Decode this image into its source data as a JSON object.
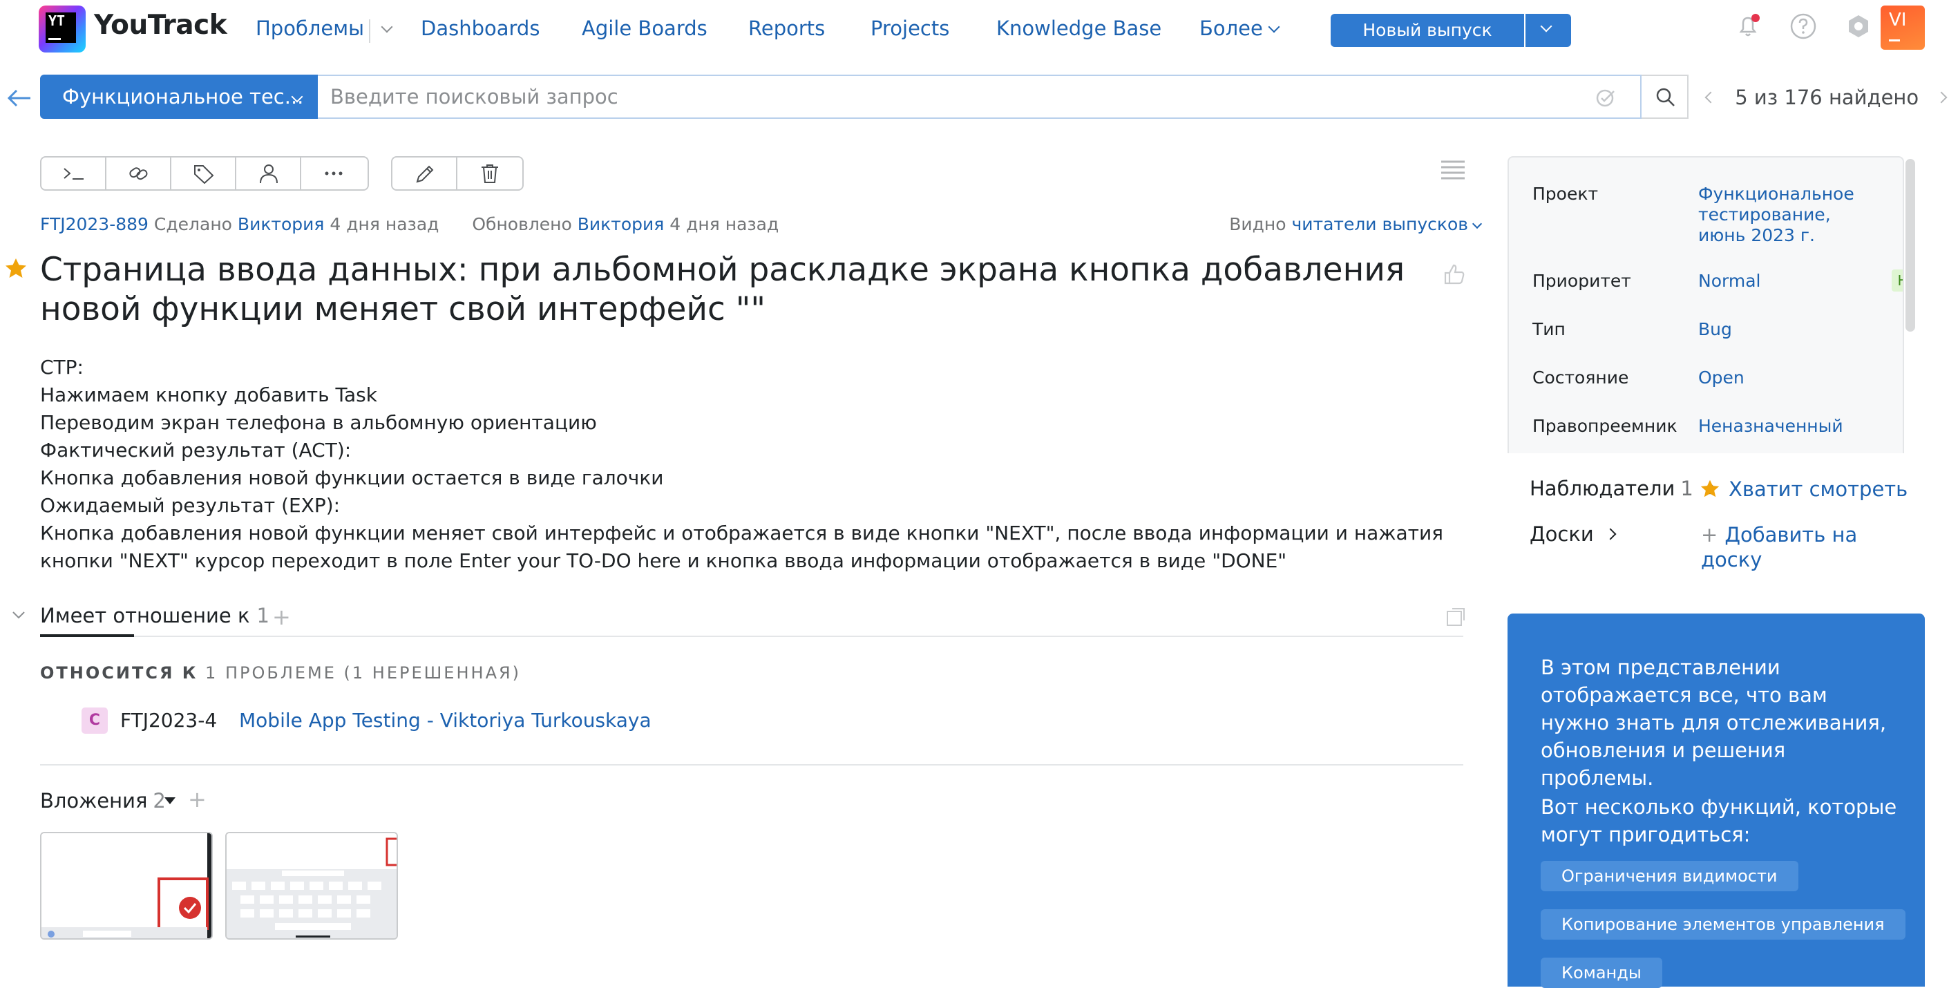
{
  "header": {
    "brand": "YouTrack",
    "logo_mark": "YT",
    "nav": [
      "Проблемы",
      "Dashboards",
      "Agile Boards",
      "Reports",
      "Projects",
      "Knowledge Base",
      "Более"
    ],
    "new_issue_label": "Новый выпуск",
    "avatar_initials": "VI",
    "icons": [
      "notifications-bell-icon",
      "help-icon",
      "settings-gear-icon"
    ],
    "notification_dot_color": "#e5344d"
  },
  "search": {
    "project_filter": "Функциональное тес...",
    "placeholder": "Введите поисковый запрос",
    "pager_text": "5 из 176 найдено"
  },
  "toolbar": {
    "group1_icons": [
      "command-icon",
      "link-icon",
      "tag-icon",
      "assignee-icon",
      "more-icon"
    ],
    "group2_icons": [
      "edit-pencil-icon",
      "delete-trash-icon"
    ]
  },
  "issue": {
    "id": "FTJ2023-889",
    "created_prefix": "Сделано",
    "created_by": "Виктория",
    "created_when": "4 дня назад",
    "updated_prefix": "Обновлено",
    "updated_by": "Виктория",
    "updated_when": "4 дня назад",
    "visibility_prefix": "Видно",
    "visibility_value": "читатели выпусков",
    "title": "Страница ввода данных: при альбомной раскладке экрана кнопка добавления новой функции меняет свой интерфейс \"\"",
    "description": [
      "СТР:",
      "Нажимаем кнопку добавить Task",
      "Переводим экран телефона в альбомную ориентацию",
      "Фактический результат (ACT):",
      "Кнопка добавления новой функции остается в виде галочки",
      "Ожидаемый результат (EXP):",
      "Кнопка добавления новой функции меняет свой интерфейс и отображается в виде кнопки \"NEXT\", после ввода информации и нажатия кнопки \"NEXT\" курсор переходит в поле Enter your TO-DO here и кнопка ввода информации отображается в виде \"DONE\""
    ]
  },
  "links": {
    "tab_label": "Имеет отношение к",
    "tab_count": "1",
    "relation_head_bold": "ОТНОСИТСЯ К",
    "relation_head_rest": "1 ПРОБЛЕМЕ (1 НЕРЕШЕННАЯ)",
    "item": {
      "badge": "C",
      "id": "FTJ2023-4",
      "summary": "Mobile App Testing - Viktoriya Turkouskaya"
    }
  },
  "attachments": {
    "label": "Вложения",
    "count": "2"
  },
  "fields": [
    {
      "label": "Проект",
      "value": "Функциональное тестирование, июнь 2023 г."
    },
    {
      "label": "Приоритет",
      "value": "Normal",
      "badge": "Н"
    },
    {
      "label": "Тип",
      "value": "Bug"
    },
    {
      "label": "Состояние",
      "value": "Open"
    },
    {
      "label": "Правопреемник",
      "value": "Неназначенный"
    }
  ],
  "watchers": {
    "label": "Наблюдатели",
    "count": "1",
    "stop_label": "Хватит смотреть"
  },
  "boards": {
    "label": "Доски",
    "add_label": "Добавить на доску"
  },
  "onboarding": {
    "text1": "В этом представлении отображается все, что вам нужно знать для отслеживания, обновления и решения проблемы.",
    "text2": "Вот несколько функций, которые могут пригодиться:",
    "chips": [
      "Ограничения видимости",
      "Копирование элементов управления",
      "Команды"
    ]
  },
  "colors": {
    "accent": "#2f7ad0",
    "link": "#1d62b0",
    "star": "#f0a30a"
  }
}
